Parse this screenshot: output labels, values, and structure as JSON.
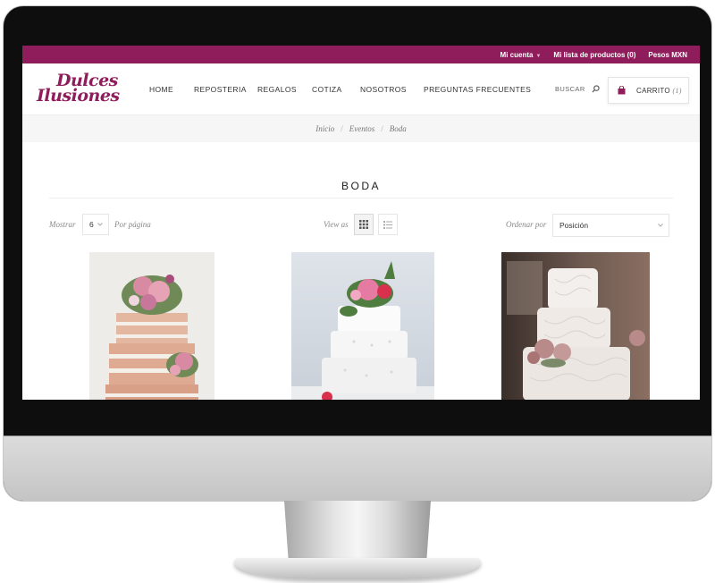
{
  "topbar": {
    "account_label": "Mi cuenta",
    "wishlist_label": "Mi lista de productos (0)",
    "currency_label": "Pesos MXN"
  },
  "brand": {
    "logo_line1": "Dulces",
    "logo_line2": "Ilusiones",
    "color": "#8f1c5b"
  },
  "nav": {
    "items": [
      {
        "label": "HOME"
      },
      {
        "label": "REPOSTERIA"
      },
      {
        "label": "REGALOS"
      },
      {
        "label": "COTIZA"
      },
      {
        "label": "NOSOTROS"
      },
      {
        "label": "PREGUNTAS FRECUENTES"
      }
    ],
    "search_label": "BUSCAR",
    "cart_label": "CARRITO",
    "cart_count": "(1)"
  },
  "breadcrumb": {
    "items": [
      "Inicio",
      "Eventos",
      "Boda"
    ]
  },
  "category": {
    "title": "BODA"
  },
  "toolbar": {
    "show_label": "Mostrar",
    "show_value": "6",
    "per_page_label": "Por página",
    "view_as_label": "View as",
    "sort_label": "Ordenar por",
    "sort_value": "Posición"
  },
  "products": [
    {
      "name": "naked-cake-pink-roses"
    },
    {
      "name": "white-fondant-cake-pink-lilies"
    },
    {
      "name": "lace-cake-dusty-roses"
    }
  ],
  "colors": {
    "accent": "#8f1c5b",
    "breadcrumb_bg": "#f6f6f6"
  }
}
